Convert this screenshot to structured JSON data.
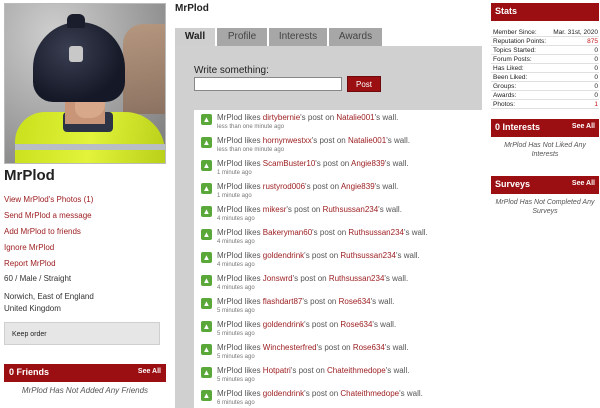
{
  "profile": {
    "username": "MrPlod",
    "links": [
      "View MrPlod's Photos (1)",
      "Send MrPlod a message",
      "Add MrPlod to friends",
      "Ignore MrPlod",
      "Report MrPlod"
    ],
    "demographics": "60 / Male / Straight",
    "location_line1": "Norwich, East of England",
    "location_line2": "United Kingdom",
    "keep_order": "Keep order"
  },
  "friends": {
    "title": "0 Friends",
    "see_all": "See All",
    "empty": "MrPlod Has Not Added Any Friends"
  },
  "main": {
    "title": "MrPlod",
    "tabs": [
      "Wall",
      "Profile",
      "Interests",
      "Awards"
    ],
    "active_tab": "Wall",
    "write_label": "Write something:",
    "write_placeholder": "",
    "post_button": "Post",
    "feed": [
      {
        "actor": "MrPlod",
        "mid1": " likes ",
        "user": "dirtybernie",
        "mid2": "'s post on ",
        "wall": "Natalie001",
        "end": "'s wall.",
        "time": "less than one minute ago"
      },
      {
        "actor": "MrPlod",
        "mid1": " likes ",
        "user": "hornynwestxx",
        "mid2": "'s post on ",
        "wall": "Natalie001",
        "end": "'s wall.",
        "time": "less than one minute ago"
      },
      {
        "actor": "MrPlod",
        "mid1": " likes ",
        "user": "ScamBuster10",
        "mid2": "'s post on ",
        "wall": "Angie839",
        "end": "'s wall.",
        "time": "1 minute ago"
      },
      {
        "actor": "MrPlod",
        "mid1": " likes ",
        "user": "rustyrod006",
        "mid2": "'s post on ",
        "wall": "Angie839",
        "end": "'s wall.",
        "time": "1 minute ago"
      },
      {
        "actor": "MrPlod",
        "mid1": " likes ",
        "user": "mikesr",
        "mid2": "'s post on ",
        "wall": "Ruthsussan234",
        "end": "'s wall.",
        "time": "4 minutes ago"
      },
      {
        "actor": "MrPlod",
        "mid1": " likes ",
        "user": "Bakeryman60",
        "mid2": "'s post on ",
        "wall": "Ruthsussan234",
        "end": "'s wall.",
        "time": "4 minutes ago"
      },
      {
        "actor": "MrPlod",
        "mid1": " likes ",
        "user": "goldendrink",
        "mid2": "'s post on ",
        "wall": "Ruthsussan234",
        "end": "'s wall.",
        "time": "4 minutes ago"
      },
      {
        "actor": "MrPlod",
        "mid1": " likes ",
        "user": "Jonswrd",
        "mid2": "'s post on ",
        "wall": "Ruthsussan234",
        "end": "'s wall.",
        "time": "4 minutes ago"
      },
      {
        "actor": "MrPlod",
        "mid1": " likes ",
        "user": "flashdart87",
        "mid2": "'s post on ",
        "wall": "Rose634",
        "end": "'s wall.",
        "time": "5 minutes ago"
      },
      {
        "actor": "MrPlod",
        "mid1": " likes ",
        "user": "goldendrink",
        "mid2": "'s post on ",
        "wall": "Rose634",
        "end": "'s wall.",
        "time": "5 minutes ago"
      },
      {
        "actor": "MrPlod",
        "mid1": " likes ",
        "user": "Winchesterfred",
        "mid2": "'s post on ",
        "wall": "Rose634",
        "end": "'s wall.",
        "time": "5 minutes ago"
      },
      {
        "actor": "MrPlod",
        "mid1": " likes ",
        "user": "Hotpatri",
        "mid2": "'s post on ",
        "wall": "Chateithmedope",
        "end": "'s wall.",
        "time": "5 minutes ago"
      },
      {
        "actor": "MrPlod",
        "mid1": " likes ",
        "user": "goldendrink",
        "mid2": "'s post on ",
        "wall": "Chateithmedope",
        "end": "'s wall.",
        "time": "6 minutes ago"
      }
    ]
  },
  "stats": {
    "title": "Stats",
    "rows": [
      {
        "k": "Member Since:",
        "v": "Mar. 31st, 2020",
        "red": false
      },
      {
        "k": "Reputation Points:",
        "v": "875",
        "red": true
      },
      {
        "k": "Topics Started:",
        "v": "0",
        "red": false
      },
      {
        "k": "Forum Posts:",
        "v": "0",
        "red": false
      },
      {
        "k": "Has Liked:",
        "v": "0",
        "red": false
      },
      {
        "k": "Been Liked:",
        "v": "0",
        "red": false
      },
      {
        "k": "Groups:",
        "v": "0",
        "red": false
      },
      {
        "k": "Awards:",
        "v": "0",
        "red": false
      },
      {
        "k": "Photos:",
        "v": "1",
        "red": true
      }
    ]
  },
  "interests": {
    "title": "0 Interests",
    "see_all": "See All",
    "empty": "MrPlod Has Not Liked Any Interests"
  },
  "surveys": {
    "title": "Surveys",
    "see_all": "See All",
    "empty": "MrPlod Has Not Completed Any Surveys"
  },
  "colors": {
    "accent": "#9b0f12",
    "link": "#9b1b1e",
    "like_icon": "#5aa83a"
  }
}
